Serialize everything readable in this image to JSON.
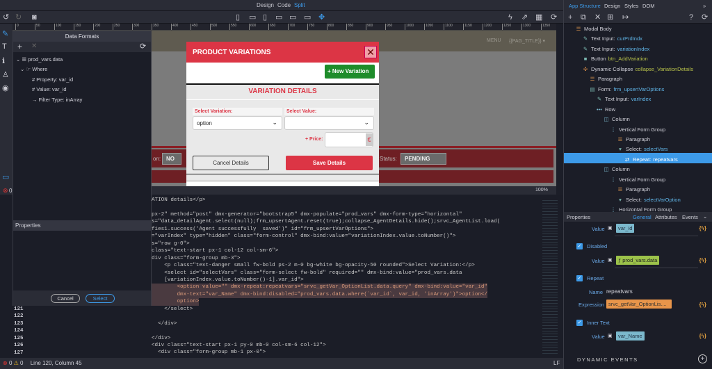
{
  "topbar": {
    "modes": [
      "Design",
      "Code",
      "Split"
    ],
    "active": "Split"
  },
  "ruler": [
    "0",
    "50",
    "100",
    "150",
    "200",
    "250",
    "300",
    "350",
    "400",
    "450",
    "500",
    "550",
    "600",
    "650",
    "700",
    "750",
    "800",
    "850",
    "900",
    "950",
    "1000",
    "1050",
    "1100",
    "1150",
    "1200",
    "1250",
    "1300",
    "1350"
  ],
  "canvas": {
    "menu": "MENU",
    "page_title": "{{PAG_TITLE}} ▾",
    "left_select": "NO",
    "left_label": "on:",
    "status_label": "Status:",
    "status_value": "PENDING",
    "zoom": "100%"
  },
  "modal": {
    "title": "PRODUCT VARIATIONS",
    "close": "✕",
    "new_variation": "New Variation",
    "section_title": "VARIATION DETAILS",
    "select_variation_label": "Select Variation:",
    "select_variation_value": "option",
    "select_value_label": "Select Value:",
    "select_value_value": "",
    "price_label": "+ Price:",
    "currency": "€",
    "cancel": "Cancel Details",
    "save": "Save Details"
  },
  "dialog": {
    "title": "Data Formats",
    "tree": [
      {
        "label": "prod_vars.data",
        "icon": "list-icon"
      },
      {
        "label": "Where",
        "icon": "hand-pointer-icon"
      },
      {
        "label": "Property: var_id",
        "icon": "hash-icon"
      },
      {
        "label": "Value: var_id",
        "icon": "hash-icon"
      },
      {
        "label": "Filter Type: inArray",
        "icon": "arrow-right-icon"
      }
    ],
    "properties_title": "Properties",
    "cancel": "Cancel",
    "select": "Select"
  },
  "code": {
    "lines": [
      "ATION details</p>",
      "",
      "px-2\" method=\"post\" dmx-generator=\"bootstrap5\" dmx-populate=\"prod_vars\" dmx-form-type=\"horizontal\"",
      "s=\"data_detailAgent.select(null);frm_upsertAgent.reset(true);collapse_AgentDetails.hide();srvc_AgentList.load(",
      "fies1.success('Agent successfully  saved')\" id=\"frm_upsertVarOptions\">",
      "=\"varIndex\" type=\"hidden\" class=\"form-control\" dmx-bind:value=\"variationIndex.value.toNumber()\">",
      "s=\"row g-0\">",
      "class=\"text-start px-1 col-12 col-sm-6\">",
      "div class=\"form-group mb-3\">",
      "    <p class=\"text-danger small fw-bold ps-2 m-0 bg-white bg-opacity-50 rounded\">Select Variation:</p>",
      "    <select id=\"selectVars\" class=\"form-select fw-bold\" required=\"\" dmx-bind:value=\"prod_vars.data",
      "    [variationIndex.value.toNumber()-1].var_id\">",
      "        <option value=\"\" dmx-repeat:repeatvars=\"srvc_getVar_OptionList.data.query\" dmx-bind:value=\"var_id\"",
      "        dmx-text=\"var_Name\" dmx-bind:disabled=\"prod_vars.data.where(`var_id`, var_id, 'inArray')\">option</",
      "        option>",
      "    </select>",
      "",
      "  </div>",
      "",
      "</div>",
      "<div class=\"text-start px-1 py-0 mb-0 col-sm-6 col-12\">",
      "  <div class=\"form-group mb-1 px-0\">"
    ],
    "line_numbers": [
      "121",
      "122",
      "123",
      "124",
      "125",
      "126",
      "127"
    ]
  },
  "statusbar": {
    "errors": "0",
    "warnings": "0",
    "position": "Line 120, Column 45",
    "eol": "LF",
    "canvas_errors": "0"
  },
  "right": {
    "tabs": [
      "App Structure",
      "Design",
      "Styles",
      "DOM"
    ],
    "tree": [
      {
        "type": "Modal Body",
        "ref": ""
      },
      {
        "type": "Text Input:",
        "ref": "curPrdIndx"
      },
      {
        "type": "Text Input:",
        "ref": "variationIndex"
      },
      {
        "type": "Button",
        "ref": "btn_AddVariation"
      },
      {
        "type": "Dynamic Collapse",
        "ref": "collapse_VariationDetails"
      },
      {
        "type": "Paragraph",
        "ref": ""
      },
      {
        "type": "Form:",
        "ref": "frm_upsertVarOptions"
      },
      {
        "type": "Text Input:",
        "ref": "varIndex"
      },
      {
        "type": "Row",
        "ref": ""
      },
      {
        "type": "Column",
        "ref": ""
      },
      {
        "type": "Vertical Form Group",
        "ref": ""
      },
      {
        "type": "Paragraph",
        "ref": ""
      },
      {
        "type": "Select:",
        "ref": "selectVars"
      },
      {
        "type": "Repeat:",
        "ref": "repeatvars"
      },
      {
        "type": "Column",
        "ref": ""
      },
      {
        "type": "Vertical Form Group",
        "ref": ""
      },
      {
        "type": "Paragraph",
        "ref": ""
      },
      {
        "type": "Select:",
        "ref": "selectVarOption"
      },
      {
        "type": "Horizontal Form Group",
        "ref": ""
      }
    ],
    "properties": {
      "title": "Properties",
      "tabs": [
        "General",
        "Attributes",
        "Events"
      ],
      "value_label": "Value",
      "value1": "var_id",
      "disabled_label": "Disabled",
      "value2": "ƒ prod_vars.data",
      "repeat_label": "Repeat",
      "name_label": "Name",
      "name_value": "repeatvars",
      "expression_label": "Expression",
      "expression_value": "srvc_getVar_OptionLis....",
      "inner_text_label": "Inner Text",
      "value3": "var_Name",
      "dynamic_events": "DYNAMIC EVENTS"
    }
  },
  "colors": {
    "accent": "#3d9ae8",
    "danger": "#dc3545",
    "success": "#1e8c2a"
  }
}
